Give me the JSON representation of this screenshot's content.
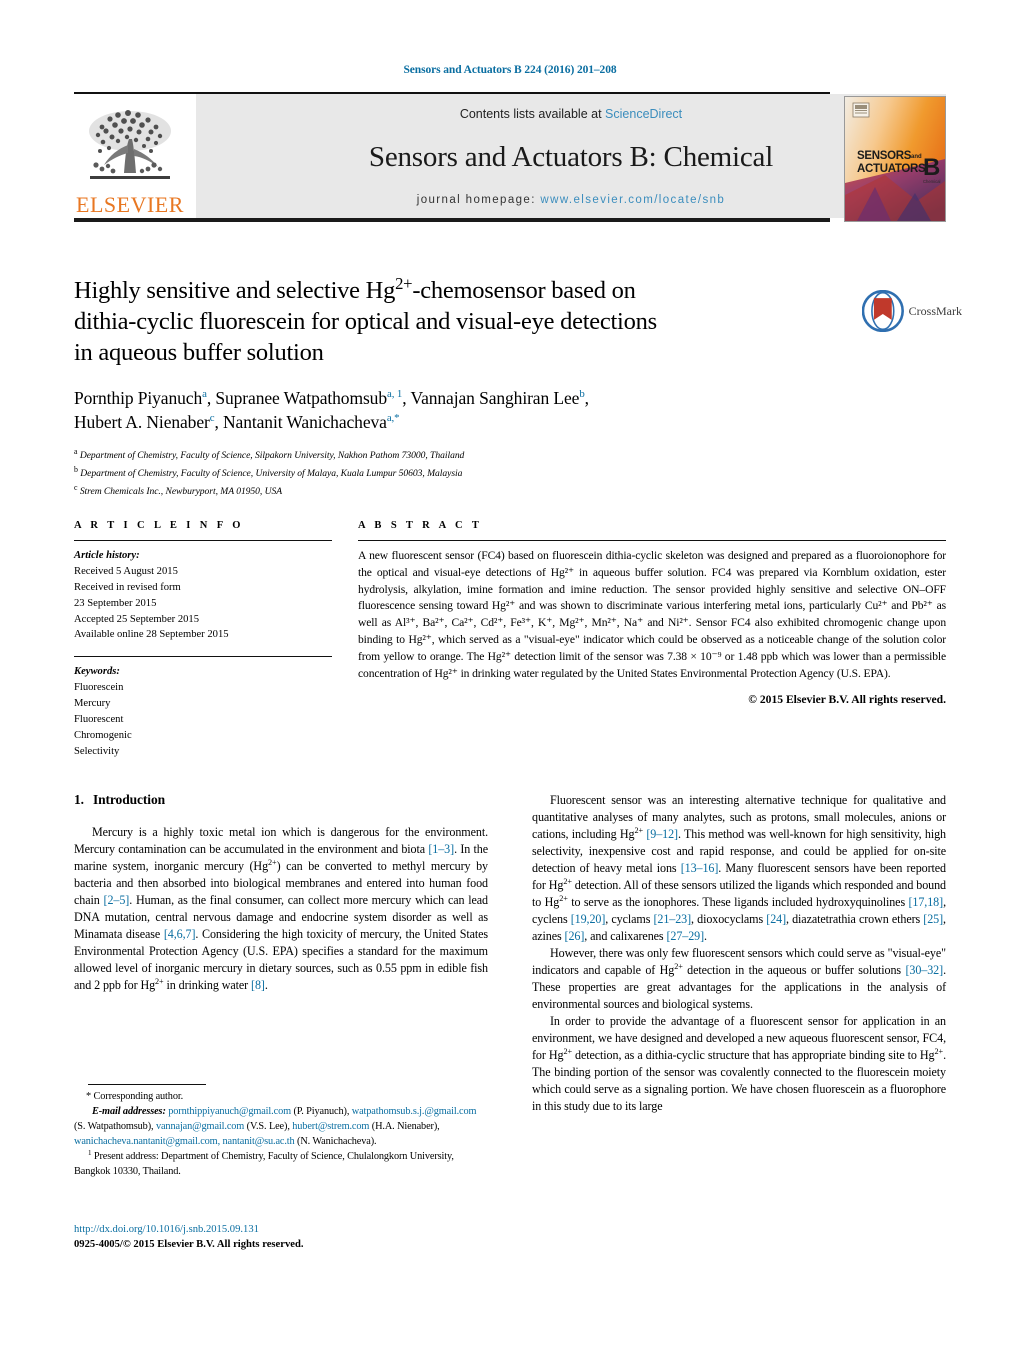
{
  "running_head": "Sensors and Actuators B 224 (2016) 201–208",
  "masthead": {
    "contents_prefix": "Contents lists available at",
    "sciencedirect": "ScienceDirect",
    "journal_title": "Sensors and Actuators B: Chemical",
    "homepage_prefix": "journal homepage:",
    "homepage_url": "www.elsevier.com/locate/snb",
    "publisher_wordmark": "ELSEVIER",
    "publisher_color": "#E87722",
    "link_color": "#3b8dbd",
    "band_color": "#e8e8e8",
    "cover_line1": "SENSORS",
    "cover_and": "and",
    "cover_line2": "ACTUATORS",
    "cover_letter": "B",
    "cover_sub": "Chemical"
  },
  "crossmark": {
    "label": "CrossMark"
  },
  "article": {
    "title_line1": "Highly sensitive and selective Hg",
    "title_sup1": "2+",
    "title_line1b": "-chemosensor based on",
    "title_line2": "dithia-cyclic fluorescein for optical and visual-eye detections",
    "title_line3": "in aqueous buffer solution",
    "authors_line1_a": "Pornthip Piyanuch",
    "authors_sup1": "a",
    "authors_line1_b": ", Supranee Watpathomsub",
    "authors_sup2": "a, 1",
    "authors_line1_c": ", Vannajan Sanghiran Lee",
    "authors_sup3": "b",
    "authors_line1_d": ",",
    "authors_line2_a": "Hubert A. Nienaber",
    "authors_sup4": "c",
    "authors_line2_b": ", Nantanit Wanichacheva",
    "authors_sup5": "a,",
    "authors_sup5b": "*",
    "affiliations": [
      {
        "mark": "a",
        "text": "Department of Chemistry, Faculty of Science, Silpakorn University, Nakhon Pathom 73000, Thailand"
      },
      {
        "mark": "b",
        "text": "Department of Chemistry, Faculty of Science, University of Malaya, Kuala Lumpur 50603, Malaysia"
      },
      {
        "mark": "c",
        "text": "Strem Chemicals Inc., Newburyport, MA 01950, USA"
      }
    ]
  },
  "article_info": {
    "heading": "A R T I C L E     I N F O",
    "history_label": "Article history:",
    "history": [
      "Received 5 August 2015",
      "Received in revised form",
      "23 September 2015",
      "Accepted 25 September 2015",
      "Available online 28 September 2015"
    ],
    "keywords_label": "Keywords:",
    "keywords": [
      "Fluorescein",
      "Mercury",
      "Fluorescent",
      "Chromogenic",
      "Selectivity"
    ]
  },
  "abstract": {
    "heading": "A B S T R A C T",
    "text": "A new fluorescent sensor (FC4) based on fluorescein dithia-cyclic skeleton was designed and prepared as a fluoroionophore for the optical and visual-eye detections of Hg²⁺ in aqueous buffer solution. FC4 was prepared via Kornblum oxidation, ester hydrolysis, alkylation, imine formation and imine reduction. The sensor provided highly sensitive and selective ON–OFF fluorescence sensing toward Hg²⁺ and was shown to discriminate various interfering metal ions, particularly Cu²⁺ and Pb²⁺ as well as Al³⁺, Ba²⁺, Ca²⁺, Cd²⁺, Fe³⁺, K⁺, Mg²⁺, Mn²⁺, Na⁺ and Ni²⁺. Sensor FC4 also exhibited chromogenic change upon binding to Hg²⁺, which served as a \"visual-eye\" indicator which could be observed as a noticeable change of the solution color from yellow to orange. The Hg²⁺ detection limit of the sensor was 7.38 × 10⁻⁹ or 1.48 ppb which was lower than a permissible concentration of Hg²⁺ in drinking water regulated by the United States Environmental Protection Agency (U.S. EPA).",
    "copyright": "© 2015 Elsevier B.V. All rights reserved."
  },
  "sections": {
    "intro_number": "1.",
    "intro_title": "Introduction"
  },
  "body": {
    "left_p1": "Mercury is a highly toxic metal ion which is dangerous for the environment. Mercury contamination can be accumulated in the environment and biota [1–3]. In the marine system, inorganic mercury (Hg2+) can be converted to methyl mercury by bacteria and then absorbed into biological membranes and entered into human food chain [2–5]. Human, as the final consumer, can collect more mercury which can lead DNA mutation, central nervous damage and endocrine system disorder as well as Minamata disease [4,6,7]. Considering the high toxicity of mercury, the United States Environmental Protection Agency (U.S. EPA) specifies a standard for the maximum allowed level of inorganic mercury in dietary sources, such as 0.55 ppm in edible fish and 2 ppb for Hg2+ in drinking water [8].",
    "right_p1": "Fluorescent sensor was an interesting alternative technique for qualitative and quantitative analyses of many analytes, such as protons, small molecules, anions or cations, including Hg2+ [9–12]. This method was well-known for high sensitivity, high selectivity, inexpensive cost and rapid response, and could be applied for on-site detection of heavy metal ions [13–16]. Many fluorescent sensors have been reported for Hg2+ detection. All of these sensors utilized the ligands which responded and bound to Hg2+ to serve as the ionophores. These ligands included hydroxyquinolines [17,18], cyclens [19,20], cyclams [21–23], dioxocyclams [24], diazatetrathia crown ethers [25], azines [26], and calixarenes [27–29].",
    "right_p2": "However, there was only few fluorescent sensors which could serve as \"visual-eye\" indicators and capable of Hg2+ detection in the aqueous or buffer solutions [30–32]. These properties are great advantages for the applications in the analysis of environmental sources and biological systems.",
    "right_p3": "In order to provide the advantage of a fluorescent sensor for application in an environment, we have designed and developed a new aqueous fluorescent sensor, FC4, for Hg2+ detection, as a dithia-cyclic structure that has appropriate binding site to Hg2+. The binding portion of the sensor was covalently connected to the fluorescein moiety which could serve as a signaling portion. We have chosen fluorescein as a fluorophore in this study due to its large"
  },
  "footnotes": {
    "corresponding": "* Corresponding author.",
    "email_label": "E-mail addresses:",
    "emails": [
      {
        "address": "pornthippiyanuch@gmail.com",
        "name": "(P. Piyanuch),"
      },
      {
        "address": "watpathomsub.s.j.@gmail.com",
        "name": "(S. Watpathomsub),"
      },
      {
        "address": "vannajan@gmail.com",
        "name": "(V.S. Lee),"
      },
      {
        "address": "hubert@strem.com",
        "name": "(H.A. Nienaber),"
      },
      {
        "address": "wanichacheva.nantanit@gmail.com,",
        "name": ""
      },
      {
        "address": "nantanit@su.ac.th",
        "name": "(N. Wanichacheva)."
      }
    ],
    "present_address_marker": "1",
    "present_address": "Present address: Department of Chemistry, Faculty of Science, Chulalongkorn University, Bangkok 10330, Thailand."
  },
  "footer": {
    "doi": "http://dx.doi.org/10.1016/j.snb.2015.09.131",
    "issn_line": "0925-4005/© 2015 Elsevier B.V. All rights reserved."
  }
}
